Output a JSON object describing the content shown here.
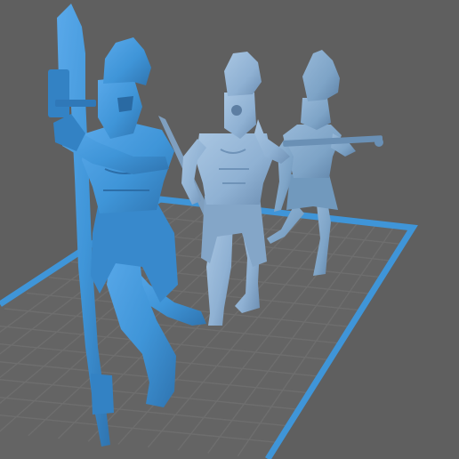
{
  "scene": {
    "background": "#5f5f5f",
    "bed_grid_color": "#6e6e6e",
    "bed_border_color": "#3f95d8",
    "model_color_selected": "#3f95d8",
    "model_color_mid": "#8fb1d3",
    "model_color_back": "#7ea4c7",
    "models": [
      {
        "name": "selected-warrior-with-rifle",
        "state": "selected"
      },
      {
        "name": "warrior-saluting",
        "state": "unselected"
      },
      {
        "name": "warrior-aiming-rifle",
        "state": "unselected"
      }
    ]
  }
}
